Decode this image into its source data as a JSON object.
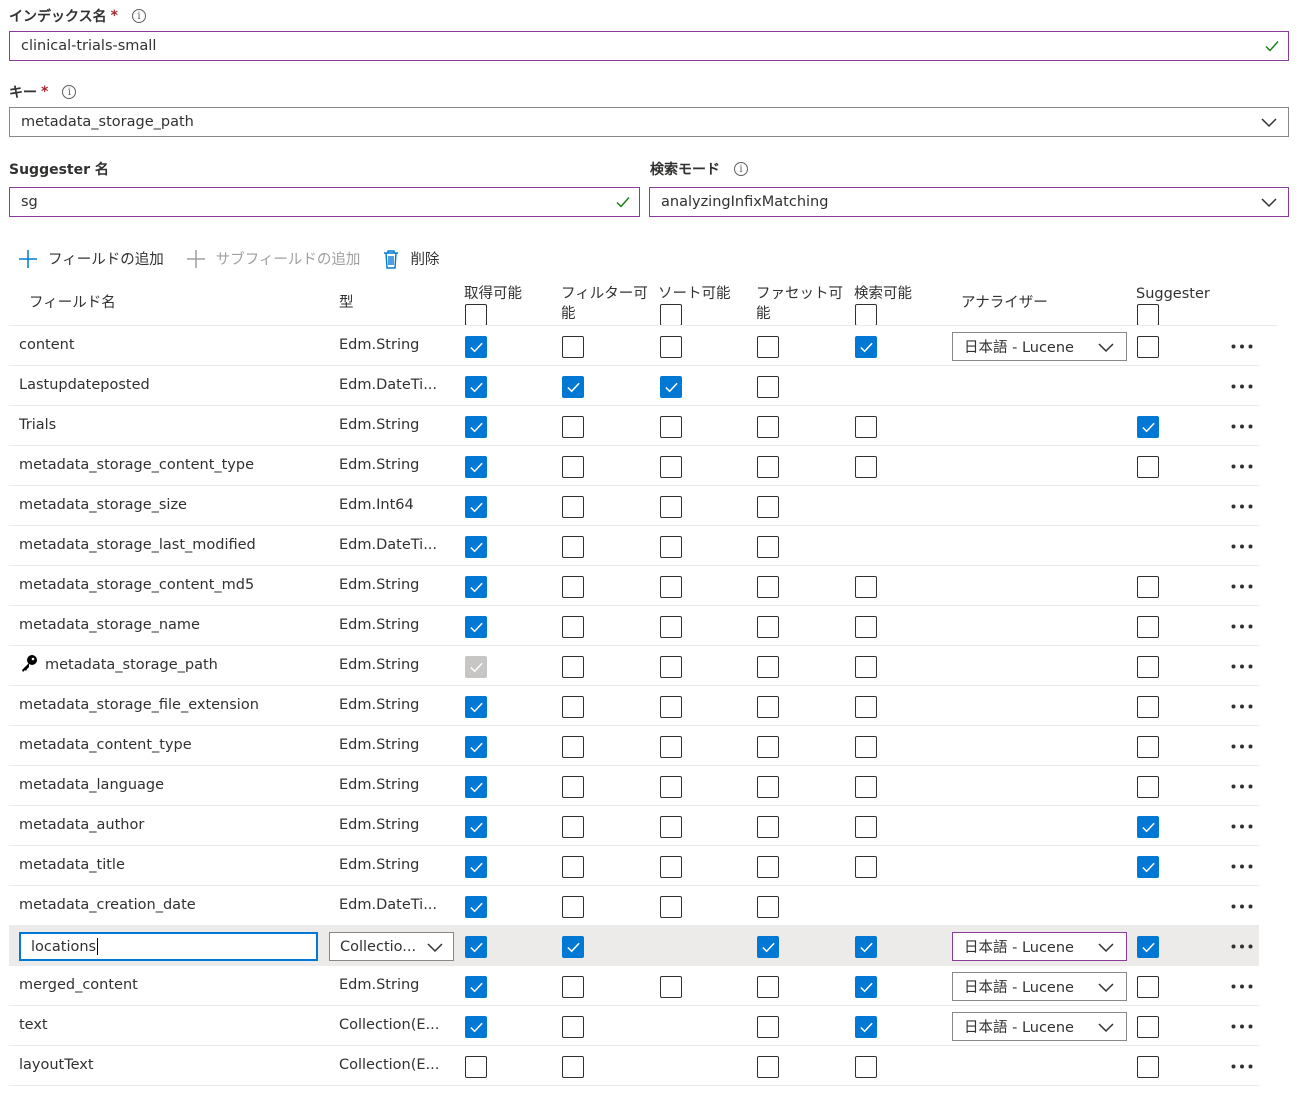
{
  "index_name": {
    "label": "インデックス名",
    "value": "clinical-trials-small"
  },
  "key": {
    "label": "キー",
    "value": "metadata_storage_path"
  },
  "suggester": {
    "label": "Suggester 名",
    "value": "sg"
  },
  "search_mode": {
    "label": "検索モード",
    "value": "analyzingInfixMatching"
  },
  "toolbar": {
    "add_field": "フィールドの追加",
    "add_subfield": "サブフィールドの追加",
    "delete": "削除"
  },
  "columns": {
    "field_name": "フィールド名",
    "type": "型",
    "retrievable": "取得可能",
    "filterable_1": "フィルター可",
    "filterable_2": "能",
    "sortable": "ソート可能",
    "facetable_1": "ファセット可",
    "facetable_2": "能",
    "searchable": "検索可能",
    "analyzer": "アナライザー",
    "suggester": "Suggester"
  },
  "rows": [
    {
      "name": "content",
      "type": "Edm.String",
      "r": 1,
      "f": 0,
      "s": 0,
      "fa": 0,
      "se": 1,
      "an": "日本語 - Lucene",
      "su": 0
    },
    {
      "name": "Lastupdateposted",
      "type": "Edm.DateTi...",
      "r": 1,
      "f": 1,
      "s": 1,
      "fa": 0,
      "se": null,
      "an": null,
      "su": null
    },
    {
      "name": "Trials",
      "type": "Edm.String",
      "r": 1,
      "f": 0,
      "s": 0,
      "fa": 0,
      "se": 0,
      "an": null,
      "su": 1
    },
    {
      "name": "metadata_storage_content_type",
      "type": "Edm.String",
      "r": 1,
      "f": 0,
      "s": 0,
      "fa": 0,
      "se": 0,
      "an": null,
      "su": 0
    },
    {
      "name": "metadata_storage_size",
      "type": "Edm.Int64",
      "r": 1,
      "f": 0,
      "s": 0,
      "fa": 0,
      "se": null,
      "an": null,
      "su": null
    },
    {
      "name": "metadata_storage_last_modified",
      "type": "Edm.DateTi...",
      "r": 1,
      "f": 0,
      "s": 0,
      "fa": 0,
      "se": null,
      "an": null,
      "su": null
    },
    {
      "name": "metadata_storage_content_md5",
      "type": "Edm.String",
      "r": 1,
      "f": 0,
      "s": 0,
      "fa": 0,
      "se": 0,
      "an": null,
      "su": 0
    },
    {
      "name": "metadata_storage_name",
      "type": "Edm.String",
      "r": 1,
      "f": 0,
      "s": 0,
      "fa": 0,
      "se": 0,
      "an": null,
      "su": 0
    },
    {
      "name": "metadata_storage_path",
      "type": "Edm.String",
      "r": 2,
      "f": 0,
      "s": 0,
      "fa": 0,
      "se": 0,
      "an": null,
      "su": 0,
      "key": true
    },
    {
      "name": "metadata_storage_file_extension",
      "type": "Edm.String",
      "r": 1,
      "f": 0,
      "s": 0,
      "fa": 0,
      "se": 0,
      "an": null,
      "su": 0
    },
    {
      "name": "metadata_content_type",
      "type": "Edm.String",
      "r": 1,
      "f": 0,
      "s": 0,
      "fa": 0,
      "se": 0,
      "an": null,
      "su": 0
    },
    {
      "name": "metadata_language",
      "type": "Edm.String",
      "r": 1,
      "f": 0,
      "s": 0,
      "fa": 0,
      "se": 0,
      "an": null,
      "su": 0
    },
    {
      "name": "metadata_author",
      "type": "Edm.String",
      "r": 1,
      "f": 0,
      "s": 0,
      "fa": 0,
      "se": 0,
      "an": null,
      "su": 1
    },
    {
      "name": "metadata_title",
      "type": "Edm.String",
      "r": 1,
      "f": 0,
      "s": 0,
      "fa": 0,
      "se": 0,
      "an": null,
      "su": 1
    },
    {
      "name": "metadata_creation_date",
      "type": "Edm.DateTi...",
      "r": 1,
      "f": 0,
      "s": 0,
      "fa": 0,
      "se": null,
      "an": null,
      "su": null
    },
    {
      "name": "locations",
      "type": "Collectio...",
      "r": 1,
      "f": 1,
      "s": null,
      "fa": 1,
      "se": 1,
      "an": "日本語 - Lucene",
      "su": 1,
      "editing": true
    },
    {
      "name": "merged_content",
      "type": "Edm.String",
      "r": 1,
      "f": 0,
      "s": 0,
      "fa": 0,
      "se": 1,
      "an": "日本語 - Lucene",
      "su": 0
    },
    {
      "name": "text",
      "type": "Collection(E...",
      "r": 1,
      "f": 0,
      "s": null,
      "fa": 0,
      "se": 1,
      "an": "日本語 - Lucene",
      "su": 0
    },
    {
      "name": "layoutText",
      "type": "Collection(E...",
      "r": 0,
      "f": 0,
      "s": null,
      "fa": 0,
      "se": 0,
      "an": null,
      "su": 0
    }
  ],
  "colors": {
    "accent": "#0078d4",
    "valid_border": "#8a3c9b",
    "success_check": "#107c10"
  }
}
